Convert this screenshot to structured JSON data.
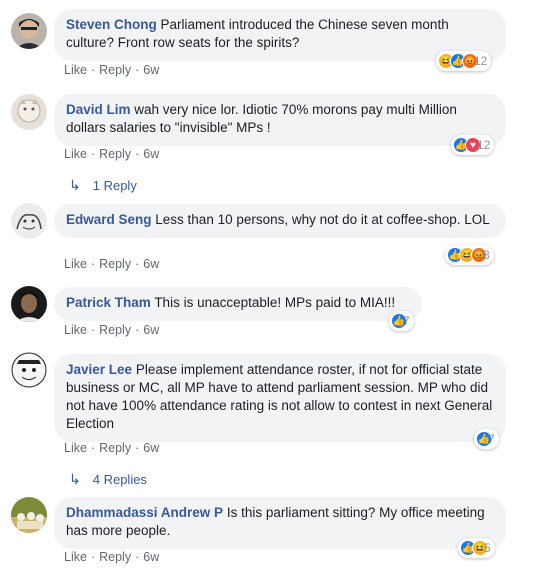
{
  "comments": [
    {
      "author": "Steven Chong",
      "text": "Parliament introduced the Chinese seven month culture? Front row seats for the spirits?",
      "like": "Like",
      "reply": "Reply",
      "time": "6w",
      "reactions": [
        "haha",
        "like",
        "angry"
      ],
      "count": "12"
    },
    {
      "author": "David Lim",
      "text": "wah very nice lor. Idiotic 70% morons pay multi Million dollars salaries to \"invisible\" MPs !",
      "like": "Like",
      "reply": "Reply",
      "time": "6w",
      "reactions": [
        "like",
        "love"
      ],
      "count": "12",
      "replies": "1 Reply"
    },
    {
      "author": "Edward Seng",
      "text": "Less than 10 persons, why not do it at coffee-shop. LOL",
      "like": "Like",
      "reply": "Reply",
      "time": "6w",
      "reactions": [
        "like",
        "haha",
        "angry"
      ],
      "count": "8"
    },
    {
      "author": "Patrick Tham",
      "text": "This is unacceptable! MPs paid to MIA!!!",
      "like": "Like",
      "reply": "Reply",
      "time": "6w",
      "reactions": [
        "like"
      ],
      "count": "7"
    },
    {
      "author": "Javier Lee",
      "text": "Please implement attendance roster, if not for official state business or MC, all MP have to attend parliament session. MP who did not have 100% attendance rating is not allow to contest in next General Election",
      "like": "Like",
      "reply": "Reply",
      "time": "6w",
      "reactions": [
        "like"
      ],
      "count": "7",
      "replies": "4 Replies"
    },
    {
      "author": "Dhammadassi Andrew P",
      "text": "Is this parliament sitting? My office meeting has more people.",
      "like": "Like",
      "reply": "Reply",
      "time": "6w",
      "reactions": [
        "like",
        "haha"
      ],
      "count": "5"
    }
  ],
  "icons": {
    "reply_arrow": "reply-arrow-icon"
  },
  "colors": {
    "author": "#385898",
    "bubble": "#f2f3f5",
    "like": "#1877f2",
    "love": "#f33e58",
    "haha": "#f7b125",
    "angry": "#e9710f"
  }
}
